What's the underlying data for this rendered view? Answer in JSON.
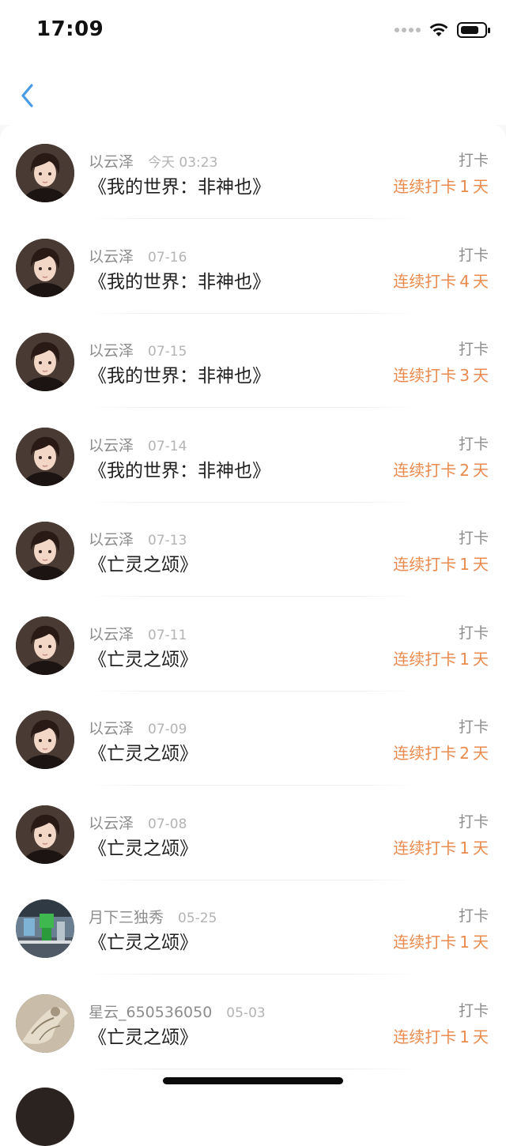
{
  "status_bar": {
    "time": "17:09"
  },
  "nav": {
    "back_icon": "chevron-left-icon",
    "accent_color": "#4a9be6"
  },
  "colors": {
    "streak": "#e98a4e",
    "muted": "#8d8d8d"
  },
  "list": {
    "items": [
      {
        "username": "以云泽",
        "date": "今天 03:23",
        "title": "《我的世界：非神也》",
        "label": "打卡",
        "streak_prefix": "连续打卡",
        "streak_days": "1",
        "streak_suffix": "天",
        "avatar": "anime-boy"
      },
      {
        "username": "以云泽",
        "date": "07-16",
        "title": "《我的世界：非神也》",
        "label": "打卡",
        "streak_prefix": "连续打卡",
        "streak_days": "4",
        "streak_suffix": "天",
        "avatar": "anime-boy"
      },
      {
        "username": "以云泽",
        "date": "07-15",
        "title": "《我的世界：非神也》",
        "label": "打卡",
        "streak_prefix": "连续打卡",
        "streak_days": "3",
        "streak_suffix": "天",
        "avatar": "anime-boy"
      },
      {
        "username": "以云泽",
        "date": "07-14",
        "title": "《我的世界：非神也》",
        "label": "打卡",
        "streak_prefix": "连续打卡",
        "streak_days": "2",
        "streak_suffix": "天",
        "avatar": "anime-boy"
      },
      {
        "username": "以云泽",
        "date": "07-13",
        "title": "《亡灵之颂》",
        "label": "打卡",
        "streak_prefix": "连续打卡",
        "streak_days": "1",
        "streak_suffix": "天",
        "avatar": "anime-boy"
      },
      {
        "username": "以云泽",
        "date": "07-11",
        "title": "《亡灵之颂》",
        "label": "打卡",
        "streak_prefix": "连续打卡",
        "streak_days": "1",
        "streak_suffix": "天",
        "avatar": "anime-boy"
      },
      {
        "username": "以云泽",
        "date": "07-09",
        "title": "《亡灵之颂》",
        "label": "打卡",
        "streak_prefix": "连续打卡",
        "streak_days": "2",
        "streak_suffix": "天",
        "avatar": "anime-boy"
      },
      {
        "username": "以云泽",
        "date": "07-08",
        "title": "《亡灵之颂》",
        "label": "打卡",
        "streak_prefix": "连续打卡",
        "streak_days": "1",
        "streak_suffix": "天",
        "avatar": "anime-boy"
      },
      {
        "username": "月下三独秀",
        "date": "05-25",
        "title": "《亡灵之颂》",
        "label": "打卡",
        "streak_prefix": "连续打卡",
        "streak_days": "1",
        "streak_suffix": "天",
        "avatar": "game-scene"
      },
      {
        "username": "星云_650536050",
        "date": "05-03",
        "title": "《亡灵之颂》",
        "label": "打卡",
        "streak_prefix": "连续打卡",
        "streak_days": "1",
        "streak_suffix": "天",
        "avatar": "sketch"
      }
    ]
  }
}
